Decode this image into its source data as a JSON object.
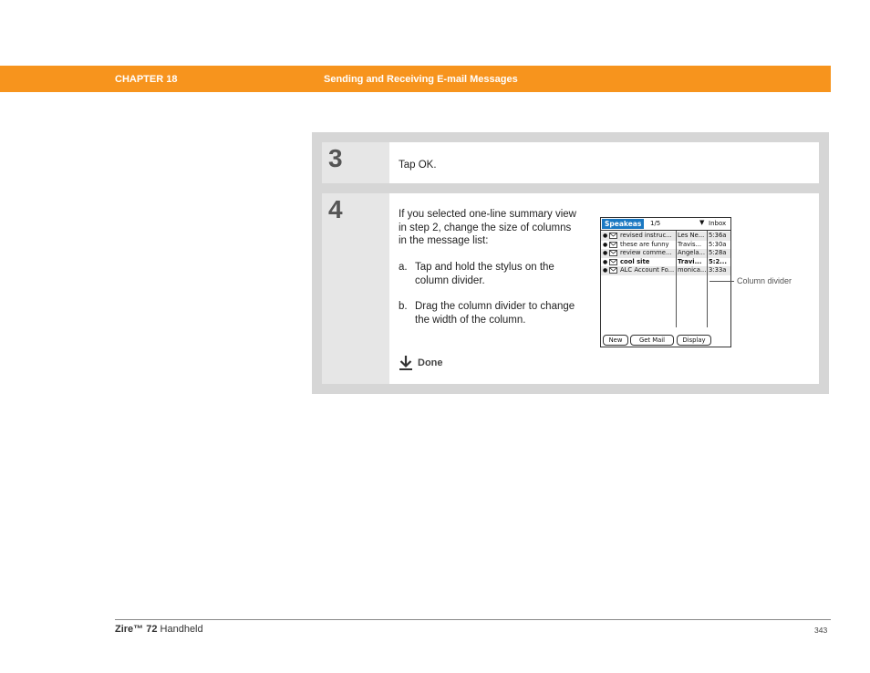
{
  "header": {
    "chapter": "CHAPTER 18",
    "title": "Sending and Receiving E-mail Messages",
    "bar_color": "#f7941d"
  },
  "steps": [
    {
      "number": "3",
      "text": "Tap OK."
    },
    {
      "number": "4",
      "intro": "If you selected one-line summary view in step 2, change the size of columns in the message list:",
      "substeps": [
        {
          "marker": "a.",
          "text": "Tap and hold the stylus on the column divider."
        },
        {
          "marker": "b.",
          "text": "Drag the column divider to change the width of the column."
        }
      ],
      "done_label": "Done",
      "done_icon": "down-arrow-done-icon"
    }
  ],
  "palm_screen": {
    "app_tab": "Speakeas",
    "page_indicator": "1/5",
    "folder_arrow": "▼",
    "folder": "Inbox",
    "messages": [
      {
        "subject": "revised instruc...",
        "from": "Les Ne...",
        "time": "5:36a"
      },
      {
        "subject": "these are funny",
        "from": "Travis...",
        "time": "5:30a"
      },
      {
        "subject": "review comme...",
        "from": "Angela...",
        "time": "5:28a"
      },
      {
        "subject": "cool site",
        "from": "Travi...",
        "time": "5:2..."
      },
      {
        "subject": "ALC Account Fo...",
        "from": "monica...",
        "time": "3:33a"
      }
    ],
    "buttons": {
      "new": "New",
      "get_mail": "Get Mail",
      "display": "Display"
    },
    "callout": "Column divider"
  },
  "footer": {
    "product_bold": "Zire™ 72",
    "product_rest": " Handheld",
    "page_number": "343"
  }
}
